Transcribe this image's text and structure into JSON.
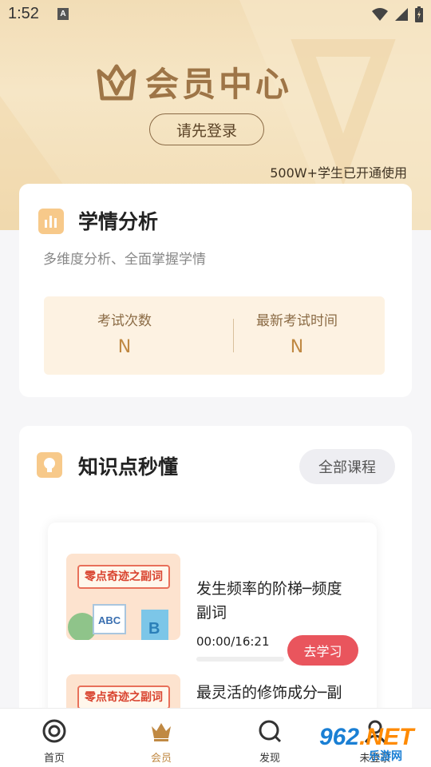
{
  "status_bar": {
    "time": "1:52",
    "notification_icon": "A"
  },
  "hero": {
    "title": "会员中心",
    "login_button": "请先登录",
    "users_note": "500W+学生已开通使用",
    "colors": {
      "gold": "#9e7547"
    }
  },
  "analysis": {
    "title": "学情分析",
    "subtitle": "多维度分析、全面掌握学情",
    "stats": [
      {
        "label": "考试次数",
        "value": "N"
      },
      {
        "label": "最新考试时间",
        "value": "N"
      }
    ]
  },
  "knowledge": {
    "title": "知识点秒懂",
    "all_courses_button": "全部课程",
    "courses": [
      {
        "thumb_label": "零点奇迹之副词",
        "title": "发生频率的阶梯─频度副词",
        "duration": "00:00/16:21",
        "progress": 0,
        "action": "去学习"
      },
      {
        "thumb_label": "零点奇迹之副词",
        "title": "最灵活的修饰成分─副词的概念、分类及"
      }
    ]
  },
  "tabbar": {
    "tabs": [
      {
        "label": "首页",
        "icon": "home-icon",
        "active": false
      },
      {
        "label": "会员",
        "icon": "crown-icon",
        "active": true
      },
      {
        "label": "发现",
        "icon": "discover-icon",
        "active": false
      },
      {
        "label": "未登录",
        "icon": "profile-icon",
        "active": false
      }
    ],
    "accent": "#c08943"
  },
  "watermark": {
    "logo_digits": "962",
    "logo_suffix": ".NET",
    "site": "乐游网"
  }
}
